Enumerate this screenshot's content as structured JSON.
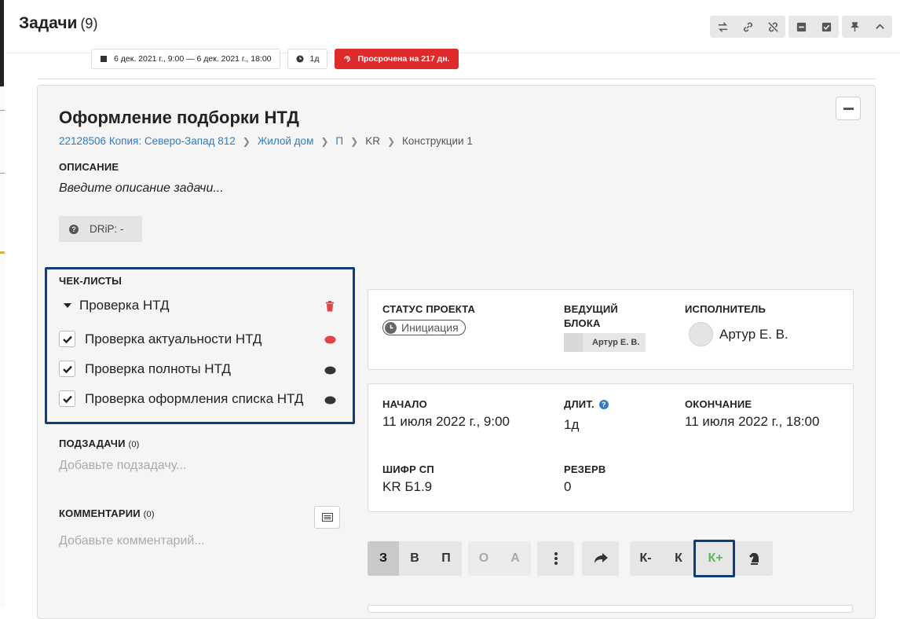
{
  "header": {
    "title": "Задачи",
    "count": "(9)"
  },
  "toolbar": {
    "icons": [
      "swap-icon",
      "link-icon",
      "unlink-icon",
      "minimize-icon",
      "check-square-icon",
      "pin-icon",
      "chevron-up-icon"
    ]
  },
  "chips": {
    "date_range": "6 дек. 2021 г., 9:00 — 6 дек. 2021 г., 18:00",
    "duration": "1д",
    "overdue": "Просрочена на 217 дн."
  },
  "task": {
    "title": "Оформление подборки НТД",
    "breadcrumb": [
      {
        "text": "22128506 Копия: Северо-Запад 812",
        "link": true
      },
      {
        "text": "Жилой дом",
        "link": true
      },
      {
        "text": "П",
        "link": true
      },
      {
        "text": "KR",
        "link": false
      },
      {
        "text": "Конструкции 1",
        "link": false
      }
    ]
  },
  "description": {
    "label": "ОПИСАНИЕ",
    "placeholder": "Введите описание задачи..."
  },
  "drip": {
    "label": "DRiP: -"
  },
  "checklists": {
    "label": "ЧЕК-ЛИСТЫ",
    "group_name": "Проверка НТД",
    "items": [
      {
        "text": "Проверка актуальности НТД",
        "checked": true,
        "comment_color": "#e04545"
      },
      {
        "text": "Проверка полноты НТД",
        "checked": true,
        "comment_color": "#333333"
      },
      {
        "text": "Проверка оформления списка НТД",
        "checked": true,
        "comment_color": "#333333"
      }
    ]
  },
  "subtasks": {
    "label": "ПОДЗАДАЧИ",
    "count": "(0)",
    "placeholder": "Добавьте подзадачу..."
  },
  "comments": {
    "label": "КОММЕНТАРИИ",
    "count": "(0)",
    "placeholder": "Добавьте комментарий..."
  },
  "project_card": {
    "status_label": "СТАТУС ПРОЕКТА",
    "status_value": "Инициация",
    "lead_label_1": "ВЕДУЩИЙ",
    "lead_label_2": "БЛОКА",
    "lead_value": "Артур Е. В.",
    "executor_label": "ИСПОЛНИТЕЛЬ",
    "executor_value": "Артур Е. В."
  },
  "schedule_card": {
    "start_label": "НАЧАЛО",
    "start_value": "11 июля 2022 г., 9:00",
    "duration_label": "ДЛИТ.",
    "duration_value": "1д",
    "end_label": "ОКОНЧАНИЕ",
    "end_value": "11 июля 2022 г., 18:00",
    "cipher_label": "ШИФР СП",
    "cipher_value": "KR Б1.9",
    "reserve_label": "РЕЗЕРВ",
    "reserve_value": "0"
  },
  "action_bar": {
    "group1": [
      "З",
      "В",
      "П"
    ],
    "group2": [
      "О",
      "А"
    ],
    "group4": [
      "К-",
      "К",
      "К+"
    ]
  },
  "colors": {
    "accent_blue": "#2f7dc4",
    "highlight_navy": "#0d3e7a",
    "overdue_red": "#de2a2a",
    "k_plus_green": "#5cb85c"
  }
}
